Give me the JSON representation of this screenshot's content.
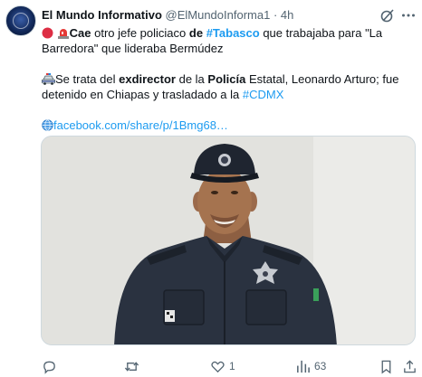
{
  "tweet": {
    "author_name": "El Mundo Informativo",
    "handle": "@ElMundoInforma1",
    "separator": "·",
    "time": "4h",
    "line1_part1": "Cae",
    "line1_part2": " otro jefe policiaco ",
    "line1_part3": "de",
    "line1_part4": " ",
    "line1_hashtag": "#Tabasco",
    "line1_part5": " que trabajaba para \"La",
    "line2": "Barredora\" que lideraba Bermúdez",
    "line3_part1": "Se trata del ",
    "line3_bold1": "exdirector",
    "line3_part2": " de la ",
    "line3_bold2": "Policía",
    "line3_part3": " Estatal, Leonardo Arturo; fue",
    "line4_part1": "detenido en Chiapas y trasladado a la ",
    "line4_hashtag": "#CDMX",
    "link_text": "facebook.com/share/p/1Bmg68…"
  },
  "actions": {
    "replies": "",
    "retweets": "",
    "likes": "1",
    "views": "63"
  },
  "colors": {
    "link": "#1d9bf0",
    "muted": "#536471",
    "text": "#0f1419"
  },
  "icons": [
    "avatar-logo",
    "grok-icon",
    "more-icon",
    "red-circle-icon",
    "siren-icon",
    "police-car-icon",
    "globe-icon",
    "reply-icon",
    "retweet-icon",
    "like-icon",
    "views-icon",
    "bookmark-icon",
    "share-icon"
  ]
}
